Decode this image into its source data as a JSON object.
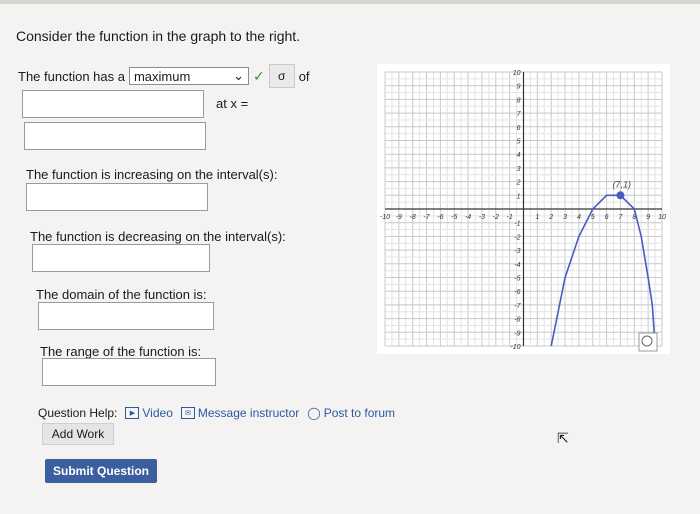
{
  "question": {
    "prompt": "Consider the function in the graph to the right.",
    "function_has_a": "The function has a",
    "selected_extremum": "maximum",
    "of": "of",
    "at_x": "at x =",
    "increasing_label": "The function is increasing on the interval(s):",
    "decreasing_label": "The function is decreasing on the interval(s):",
    "domain_label": "The domain of the function is:",
    "range_label": "The range of the function is:"
  },
  "help": {
    "label": "Question Help:",
    "video": "Video",
    "message": "Message instructor",
    "forum": "Post to forum",
    "add_work": "Add Work"
  },
  "submit_label": "Submit Question",
  "chart_data": {
    "type": "line",
    "xlim": [
      -10,
      10
    ],
    "ylim": [
      -10,
      10
    ],
    "grid": true,
    "x_ticks": [
      -10,
      -9,
      -8,
      -7,
      -6,
      -5,
      -4,
      -3,
      -2,
      -1,
      1,
      2,
      3,
      4,
      5,
      6,
      7,
      8,
      9,
      10
    ],
    "y_ticks": [
      -10,
      -9,
      -8,
      -7,
      -6,
      -5,
      -4,
      -3,
      -2,
      -1,
      1,
      2,
      3,
      4,
      5,
      6,
      7,
      8,
      9,
      10
    ],
    "vertex": {
      "x": 7,
      "y": 1,
      "label": "(7,1)"
    },
    "curve_points": [
      [
        2,
        -10
      ],
      [
        3,
        -5
      ],
      [
        4,
        -2
      ],
      [
        5,
        0
      ],
      [
        6,
        1
      ],
      [
        7,
        1
      ],
      [
        8,
        0
      ],
      [
        8.5,
        -2
      ],
      [
        9,
        -5
      ],
      [
        9.3,
        -7
      ],
      [
        9.5,
        -10
      ]
    ],
    "line_color": "#4a5cc0"
  }
}
